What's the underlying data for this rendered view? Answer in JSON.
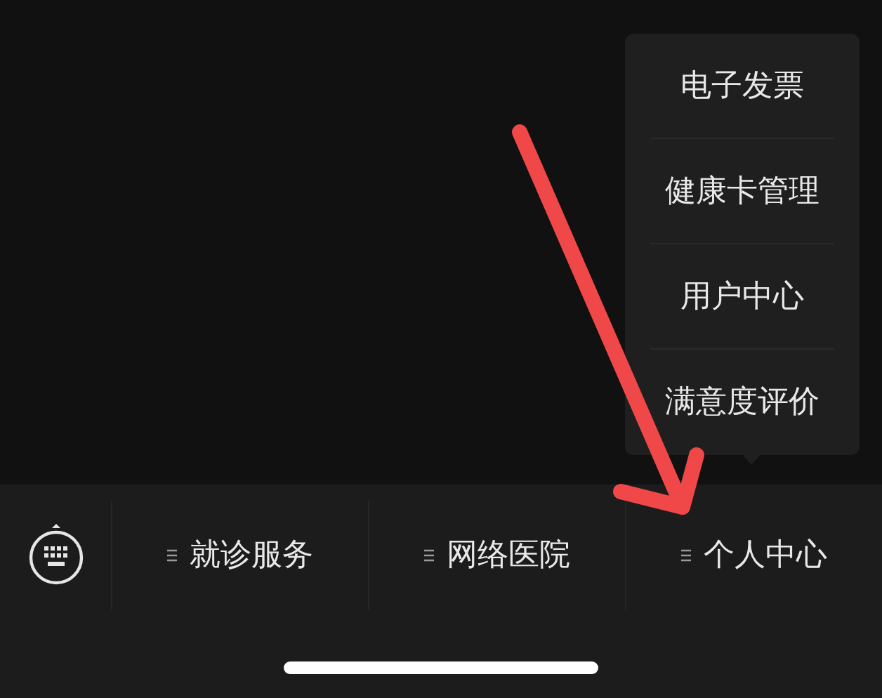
{
  "popup_menu": {
    "items": [
      {
        "label": "电子发票"
      },
      {
        "label": "健康卡管理"
      },
      {
        "label": "用户中心"
      },
      {
        "label": "满意度评价"
      }
    ]
  },
  "bottom_menu": {
    "items": [
      {
        "label": "就诊服务"
      },
      {
        "label": "网络医院"
      },
      {
        "label": "个人中心"
      }
    ]
  }
}
